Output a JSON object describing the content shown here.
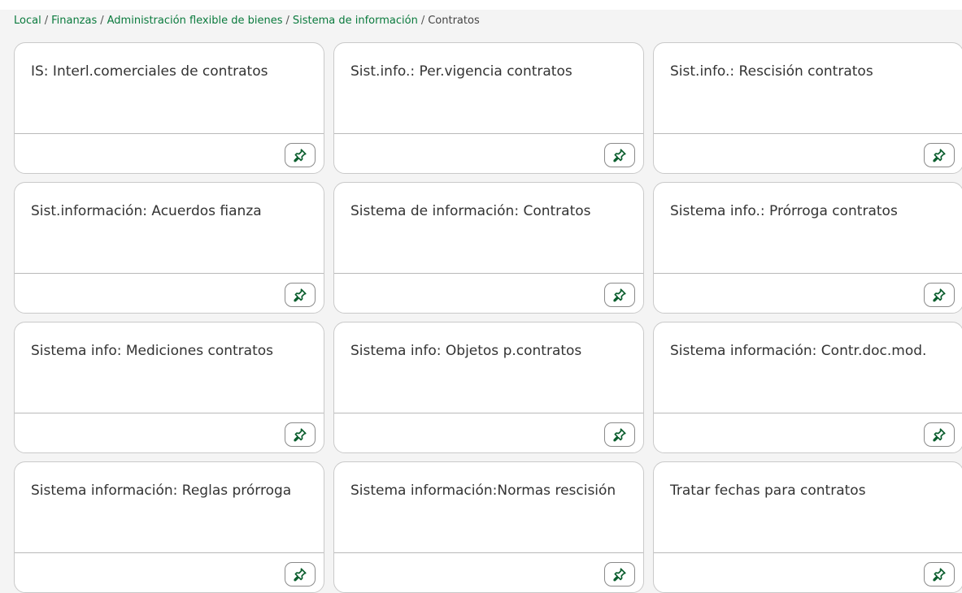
{
  "breadcrumb": {
    "items": [
      "Local",
      "Finanzas",
      "Administración flexible de bienes",
      "Sistema de información"
    ],
    "current": "Contratos",
    "separator": "/"
  },
  "tiles": [
    {
      "title": "IS: Interl.comerciales de contratos"
    },
    {
      "title": "Sist.info.: Per.vigencia contratos"
    },
    {
      "title": "Sist.info.: Rescisión contratos"
    },
    {
      "title": "Sist.información: Acuerdos fianza"
    },
    {
      "title": "Sistema de información: Contratos"
    },
    {
      "title": "Sistema info.: Prórroga contratos"
    },
    {
      "title": "Sistema info: Mediciones contratos"
    },
    {
      "title": "Sistema info: Objetos p.contratos"
    },
    {
      "title": "Sistema información: Contr.doc.mod."
    },
    {
      "title": "Sistema información: Reglas prórroga"
    },
    {
      "title": "Sistema información:Normas rescisión"
    },
    {
      "title": "Tratar fechas para contratos"
    }
  ],
  "icons": {
    "pin": "pin-icon"
  },
  "colors": {
    "link": "#0a7a3d",
    "pin": "#0b5e2e",
    "background": "#f4f4f4",
    "tile": "#ffffff"
  }
}
